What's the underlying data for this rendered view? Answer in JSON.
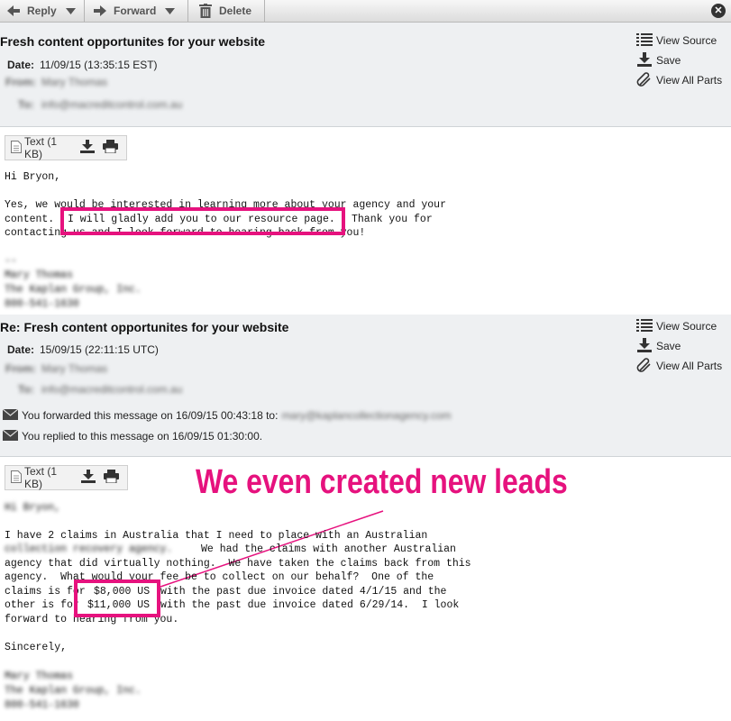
{
  "toolbar": {
    "reply_label": "Reply",
    "forward_label": "Forward",
    "delete_label": "Delete",
    "close_symbol": "✕",
    "icons": [
      "arrow-left-icon",
      "arrow-right-icon",
      "chevron-down-icon",
      "trash-icon",
      "close-icon"
    ]
  },
  "message1": {
    "subject": "Fresh content opportunites for your website",
    "date_label": "Date:",
    "date_value": "11/09/15 (13:35:15 EST)",
    "from_label": "From:",
    "from_value": "Mary Thomas",
    "to_label": "To:",
    "to_value": "info@macreditcontrol.com.au",
    "actions": {
      "view_source": "View Source",
      "save": "Save",
      "view_all_parts": "View All Parts"
    },
    "attachment": {
      "label": "Text (1 KB)"
    },
    "body": {
      "greeting": "Hi Bryon,",
      "line1": "Yes, we would be interested in learning more about your agency and your",
      "line2_start": "content.",
      "line2_highlight": "I will gladly add you to our resource page.",
      "line2_end": "Thank you for",
      "line3": "contacting us and I look forward to hearing back from you!",
      "sig_dash": "--",
      "sig1": "Mary Thomas",
      "sig2": "The Kaplan Group, Inc.",
      "sig3": "800-541-1630"
    }
  },
  "message2": {
    "subject": "Re: Fresh content opportunites for your website",
    "date_label": "Date:",
    "date_value": "15/09/15 (22:11:15 UTC)",
    "from_label": "From:",
    "from_value": "Mary Thomas",
    "to_label": "To:",
    "to_value": "info@macreditcontrol.com.au",
    "actions": {
      "view_source": "View Source",
      "save": "Save",
      "view_all_parts": "View All Parts"
    },
    "forwarded_notice": "You forwarded this message on 16/09/15 00:43:18 to:",
    "forwarded_to": "mary@kaplancollectionagency.com",
    "replied_notice": "You replied to this message on 16/09/15 01:30:00.",
    "attachment": {
      "label": "Text (1 KB)"
    },
    "body": {
      "greeting": "Hi Bryon,",
      "line1": "I have 2 claims in Australia that I need to place with an Australian",
      "line2_blur": "collection recovery agency.",
      "line2_end": "We had the claims with another Australian",
      "line3": "agency that did virtually nothing.  We have taken the claims back from this",
      "line4": "agency.  What would your fee be to collect on our behalf?  One of the",
      "line5_start": "claims is for",
      "line5_amount": "$8,000 US",
      "line5_end": "with the past due invoice dated 4/1/15 and the",
      "line6_start": "other is for",
      "line6_amount": "$11,000 US",
      "line6_end": "with the past due invoice dated 6/29/14.  I look",
      "line7": "forward to hearing from you.",
      "closing": "Sincerely,",
      "sig1": "Mary Thomas",
      "sig2": "The Kaplan Group, Inc.",
      "sig3": "800-541-1630"
    }
  },
  "annotation": {
    "text": "We even created new leads",
    "color": "#e6127e"
  }
}
